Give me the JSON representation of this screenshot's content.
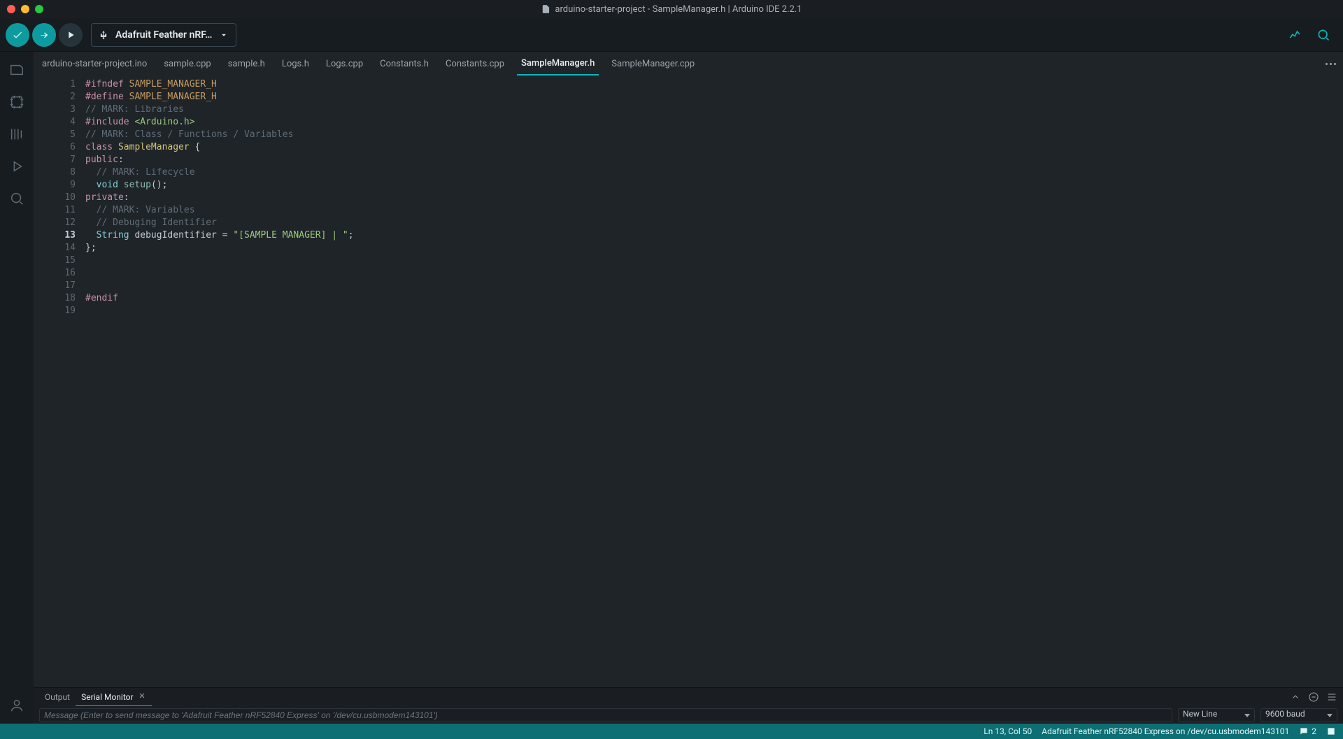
{
  "window": {
    "title": "arduino-starter-project - SampleManager.h | Arduino IDE 2.2.1"
  },
  "toolbar": {
    "board": "Adafruit Feather nRF…"
  },
  "tabs": [
    {
      "label": "arduino-starter-project.ino",
      "active": false
    },
    {
      "label": "sample.cpp",
      "active": false
    },
    {
      "label": "sample.h",
      "active": false
    },
    {
      "label": "Logs.h",
      "active": false
    },
    {
      "label": "Logs.cpp",
      "active": false
    },
    {
      "label": "Constants.h",
      "active": false
    },
    {
      "label": "Constants.cpp",
      "active": false
    },
    {
      "label": "SampleManager.h",
      "active": true
    },
    {
      "label": "SampleManager.cpp",
      "active": false
    }
  ],
  "code_lines": [
    {
      "n": 1,
      "html": "<span class='tok-pre'>#ifndef</span> <span class='tok-def'>SAMPLE_MANAGER_H</span>"
    },
    {
      "n": 2,
      "html": "<span class='tok-pre'>#define</span> <span class='tok-def'>SAMPLE_MANAGER_H</span>"
    },
    {
      "n": 3,
      "html": "<span class='tok-cmt'>// MARK: Libraries</span>"
    },
    {
      "n": 4,
      "html": "<span class='tok-pre'>#include</span> <span class='tok-inc'>&lt;Arduino.h&gt;</span>"
    },
    {
      "n": 5,
      "html": "<span class='tok-cmt'>// MARK: Class / Functions / Variables</span>"
    },
    {
      "n": 6,
      "html": "<span class='tok-kw'>class</span> <span class='tok-cls'>SampleManager</span> {"
    },
    {
      "n": 7,
      "html": "<span class='tok-kw'>public</span>:"
    },
    {
      "n": 8,
      "html": "  <span class='tok-cmt'>// MARK: Lifecycle</span>"
    },
    {
      "n": 9,
      "html": "  <span class='tok-type'>void</span> <span class='tok-func'>setup</span>();"
    },
    {
      "n": 10,
      "html": "<span class='tok-kw'>private</span>:"
    },
    {
      "n": 11,
      "html": "  <span class='tok-cmt'>// MARK: Variables</span>"
    },
    {
      "n": 12,
      "html": "  <span class='tok-cmt'>// Debuging Identifier</span>"
    },
    {
      "n": 13,
      "html": "  <span class='tok-type'>String</span> debugIdentifier = <span class='tok-str'>\"[SAMPLE MANAGER] | \"</span>;"
    },
    {
      "n": 14,
      "html": "};"
    },
    {
      "n": 15,
      "html": ""
    },
    {
      "n": 16,
      "html": ""
    },
    {
      "n": 17,
      "html": ""
    },
    {
      "n": 18,
      "html": "<span class='tok-pre'>#endif</span>"
    },
    {
      "n": 19,
      "html": ""
    }
  ],
  "current_line": 13,
  "bottom_panel": {
    "tabs": [
      {
        "label": "Output",
        "active": false
      },
      {
        "label": "Serial Monitor",
        "active": true,
        "closable": true
      }
    ],
    "input_placeholder": "Message (Enter to send message to 'Adafruit Feather nRF52840 Express' on '/dev/cu.usbmodem143101')",
    "line_ending": "New Line",
    "baud": "9600 baud"
  },
  "status": {
    "cursor": "Ln 13, Col 50",
    "board": "Adafruit Feather nRF52840 Express on /dev/cu.usbmodem143101",
    "notif_count": "2"
  }
}
